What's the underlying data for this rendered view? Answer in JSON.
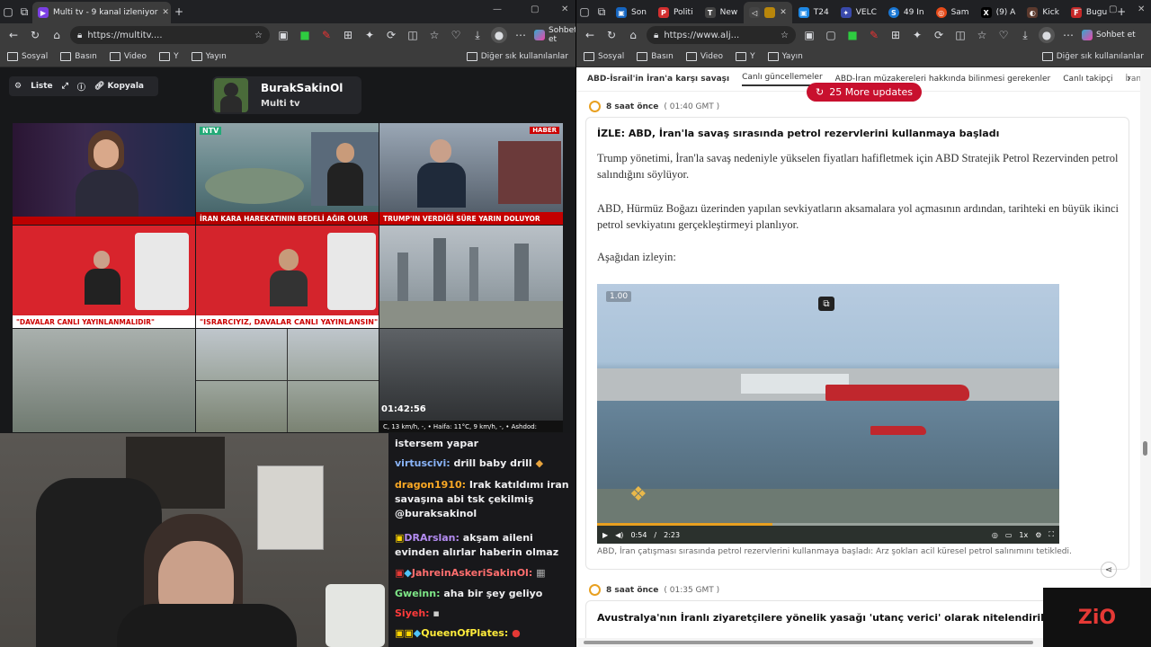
{
  "left_browser": {
    "tab": {
      "title": "Multi tv - 9 kanal izleniyor"
    },
    "address": {
      "url": "https://multitv...."
    },
    "chat_button": "Sohbet et",
    "bookmarks": [
      "Sosyal",
      "Basın",
      "Video",
      "Y",
      "Yayın"
    ],
    "bookmarks_other": "Diğer sık kullanılanlar",
    "controls": {
      "list_label": "Liste",
      "copy_label": "Kopyala"
    },
    "channel": {
      "name": "BurakSakinOl",
      "subtitle": "Multi tv"
    },
    "tiles": [
      {
        "logo": "",
        "ticker": ""
      },
      {
        "logo": "NTV",
        "ticker": "İRAN KARA HAREKATININ BEDELİ AĞIR OLUR"
      },
      {
        "logo": "HABER",
        "ticker": "TRUMP'IN VERDİĞİ SÜRE YARIN DOLUYOR"
      },
      {
        "logo": "",
        "ticker": "\"DAVALAR CANLI YAYINLANMALIDIR\""
      },
      {
        "logo": "",
        "ticker": "\"ISRARCIYIZ, DAVALAR CANLI YAYINLANSIN\""
      },
      {
        "logo": "",
        "ticker": ""
      },
      {
        "logo": "",
        "ticker": ""
      },
      {
        "logo": "",
        "ticker": ""
      },
      {
        "logo": "",
        "ticker": "01:42:56"
      }
    ],
    "weather_ticker": "C, 13 km/h, -, • Haifa: 11°C, 9 km/h, -, • Ashdod:",
    "chat": [
      {
        "user": "",
        "text": "istersem yapar"
      },
      {
        "user": "virtuscivi:",
        "text": "drill baby drill"
      },
      {
        "user": "dragon1910:",
        "text": "Irak katıldımı iran savaşına abi tsk çekilmiş @buraksakinol"
      },
      {
        "user": "DRArslan:",
        "text": "akşam aileni evinden alırlar haberin olmaz"
      },
      {
        "user": "JahreinAskeriSakinOl:",
        "text": ""
      },
      {
        "user": "Gweinn:",
        "text": "aha bir şey geliyo"
      },
      {
        "user": "Siyeh:",
        "text": ""
      },
      {
        "user": "QueenOfPlates:",
        "text": ""
      }
    ]
  },
  "right_browser": {
    "tabs": [
      "Son",
      "Politi",
      "New",
      "",
      "T24",
      "VELC",
      "49 In",
      "Sam",
      "(9) A",
      "Kick",
      "Bugu"
    ],
    "address": {
      "url": "https://www.alj..."
    },
    "chat_button": "Sohbet et",
    "bookmarks": [
      "Sosyal",
      "Basın",
      "Video",
      "Y",
      "Yayın"
    ],
    "bookmarks_other": "Diğer sık kullanılanlar",
    "page_tabs": [
      "ABD-İsrail'in İran'a karşı savaşı",
      "Canlı güncellemeler",
      "ABD-İran müzakereleri hakkında bilinmesi gerekenler",
      "Canlı takipçi",
      "İran şu anda dah"
    ],
    "more_updates": "25 More updates",
    "post1": {
      "time": "8 saat önce",
      "gmt": "( 01:40 GMT )",
      "title": "İZLE: ABD, İran'la savaş sırasında petrol rezervlerini kullanmaya başladı",
      "p1": "Trump yönetimi, İran'la savaş nedeniyle yükselen fiyatları hafifletmek için ABD Stratejik Petrol Rezervinden petrol salındığını söylüyor.",
      "p2": "ABD, Hürmüz Boğazı üzerinden yapılan sevkiyatların aksamalara yol açmasının ardından, tarihteki en büyük ikinci petrol sevkiyatını gerçekleştirmeyi planlıyor.",
      "p3": "Aşağıdan izleyin:",
      "video": {
        "speed_badge": "1.00",
        "current": "0:54",
        "duration": "2:23",
        "rate": "1x"
      },
      "caption": "ABD, İran çatışması sırasında petrol rezervlerini kullanmaya başladı: Arz şokları acil küresel petrol salınımını tetikledi."
    },
    "post2": {
      "time": "8 saat önce",
      "gmt": "( 01:35 GMT )",
      "title": "Avustralya'nın İranlı ziyaretçilere yönelik yasağı 'utanç verici' olarak nitelendirildi."
    },
    "watermark": "ZiO"
  }
}
